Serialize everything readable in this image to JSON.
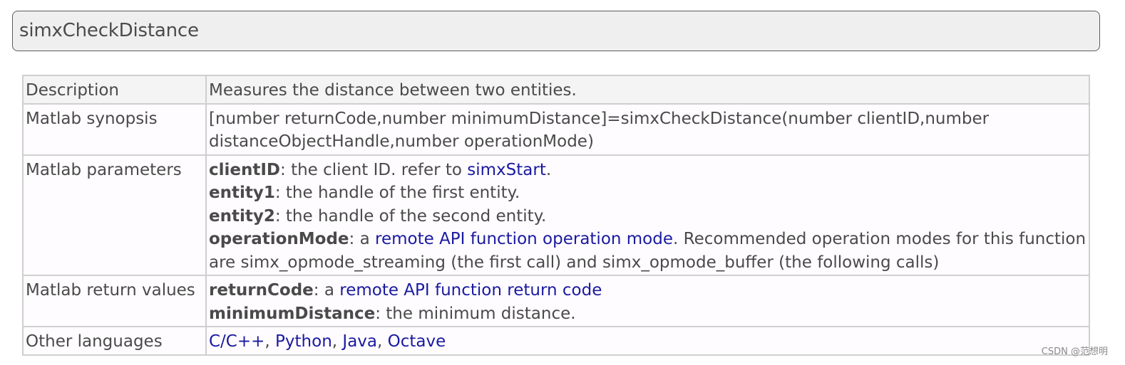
{
  "title": "simxCheckDistance",
  "rows": {
    "description": {
      "label": "Description",
      "text": "Measures the distance between two entities."
    },
    "synopsis": {
      "label": "Matlab synopsis",
      "text": "[number returnCode,number minimumDistance]=simxCheckDistance(number clientID,number distanceObjectHandle,number operationMode)"
    },
    "parameters": {
      "label": "Matlab parameters",
      "items": [
        {
          "name": "clientID",
          "pre": ": the client ID. refer to ",
          "link": "simxStart",
          "post": "."
        },
        {
          "name": "entity1",
          "pre": ": the handle of the first entity."
        },
        {
          "name": "entity2",
          "pre": ": the handle of the second entity."
        },
        {
          "name": "operationMode",
          "pre": ": a ",
          "link": "remote API function operation mode",
          "post": ". Recommended operation modes for this function are simx_opmode_streaming (the first call) and simx_opmode_buffer (the following calls)"
        }
      ]
    },
    "return_values": {
      "label": "Matlab return values",
      "items": [
        {
          "name": "returnCode",
          "pre": ": a ",
          "link": "remote API function return code"
        },
        {
          "name": "minimumDistance",
          "pre": ": the minimum distance."
        }
      ]
    },
    "other_languages": {
      "label": "Other languages",
      "links": [
        "C/C++",
        "Python",
        "Java",
        "Octave"
      ],
      "separator": ", "
    }
  },
  "watermark": "CSDN @范想明"
}
